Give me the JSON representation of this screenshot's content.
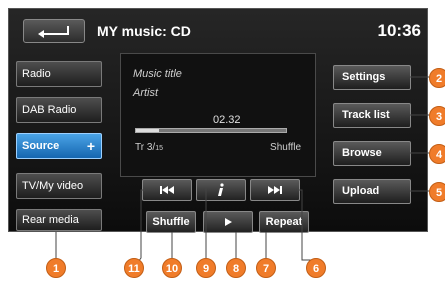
{
  "header": {
    "title": "MY music: CD",
    "clock": "10:36"
  },
  "left_menu": [
    {
      "label": "Radio"
    },
    {
      "label": "DAB Radio"
    },
    {
      "label": "Source",
      "active": true,
      "plus": "+"
    },
    {
      "label": "TV/My video"
    },
    {
      "label": "Rear media"
    }
  ],
  "now_playing": {
    "music_title": "Music title",
    "artist": "Artist",
    "elapsed": "02.32",
    "progress": 0.15,
    "track": "Tr 3/",
    "track_total": "15",
    "shuffle_status": "Shuffle"
  },
  "controls": {
    "prev_icon": "skip-previous-icon",
    "info_icon": "info-icon",
    "next_icon": "skip-next-icon",
    "shuffle_label": "Shuffle",
    "play_icon": "play-icon",
    "repeat_label": "Repeat"
  },
  "right_menu": [
    {
      "label": "Settings"
    },
    {
      "label": "Track list"
    },
    {
      "label": "Browse"
    },
    {
      "label": "Upload"
    }
  ],
  "callouts": [
    "1",
    "2",
    "3",
    "4",
    "5",
    "6",
    "7",
    "8",
    "9",
    "10",
    "11"
  ],
  "colors": {
    "callout": "#f07c2a",
    "active": "#1a7fd1"
  }
}
